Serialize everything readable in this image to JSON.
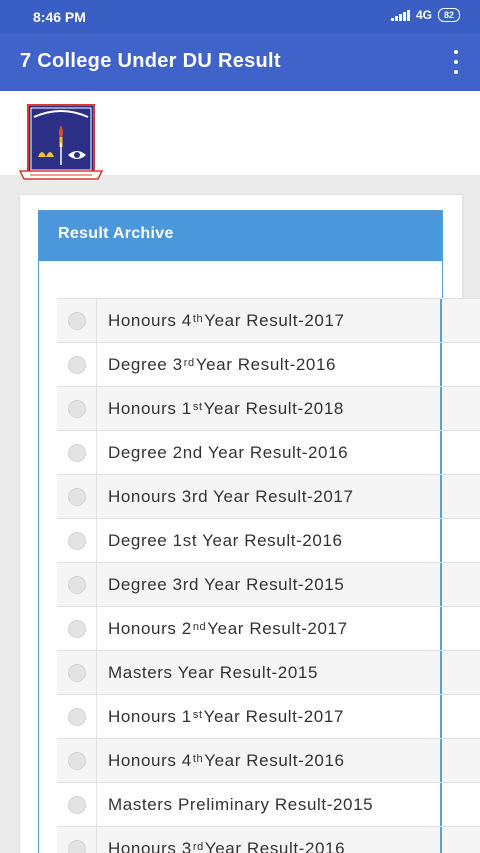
{
  "status_bar": {
    "time": "8:46 PM",
    "network": "4G",
    "battery": "82"
  },
  "app_bar": {
    "title": "7 College Under DU Result"
  },
  "logo": {
    "name": "university-logo"
  },
  "archive": {
    "header": "Result Archive",
    "items": [
      {
        "pre": "Honours 4",
        "sup": "th",
        "post": " Year Result-2017"
      },
      {
        "pre": "Degree 3",
        "sup": "rd",
        "post": " Year Result-2016"
      },
      {
        "pre": "Honours 1",
        "sup": "st",
        "post": " Year Result-2018"
      },
      {
        "pre": "Degree 2nd Year Result-2016",
        "sup": "",
        "post": ""
      },
      {
        "pre": "Honours 3rd Year Result-2017",
        "sup": "",
        "post": ""
      },
      {
        "pre": "Degree 1st Year Result-2016",
        "sup": "",
        "post": ""
      },
      {
        "pre": "Degree 3rd Year Result-2015",
        "sup": "",
        "post": ""
      },
      {
        "pre": "Honours 2",
        "sup": "nd",
        "post": " Year Result-2017"
      },
      {
        "pre": "Masters Year Result-2015",
        "sup": "",
        "post": ""
      },
      {
        "pre": "Honours 1",
        "sup": "st",
        "post": " Year Result-2017"
      },
      {
        "pre": "Honours 4",
        "sup": "th",
        "post": " Year Result-2016"
      },
      {
        "pre": "Masters Preliminary Result-2015",
        "sup": "",
        "post": ""
      },
      {
        "pre": "Honours 3",
        "sup": "rd",
        "post": " Year Result-2016"
      }
    ]
  },
  "colors": {
    "status_bar": "#3a5fc4",
    "app_bar": "#3f63c9",
    "panel_header": "#4b97db",
    "panel_border": "#56a0de"
  }
}
